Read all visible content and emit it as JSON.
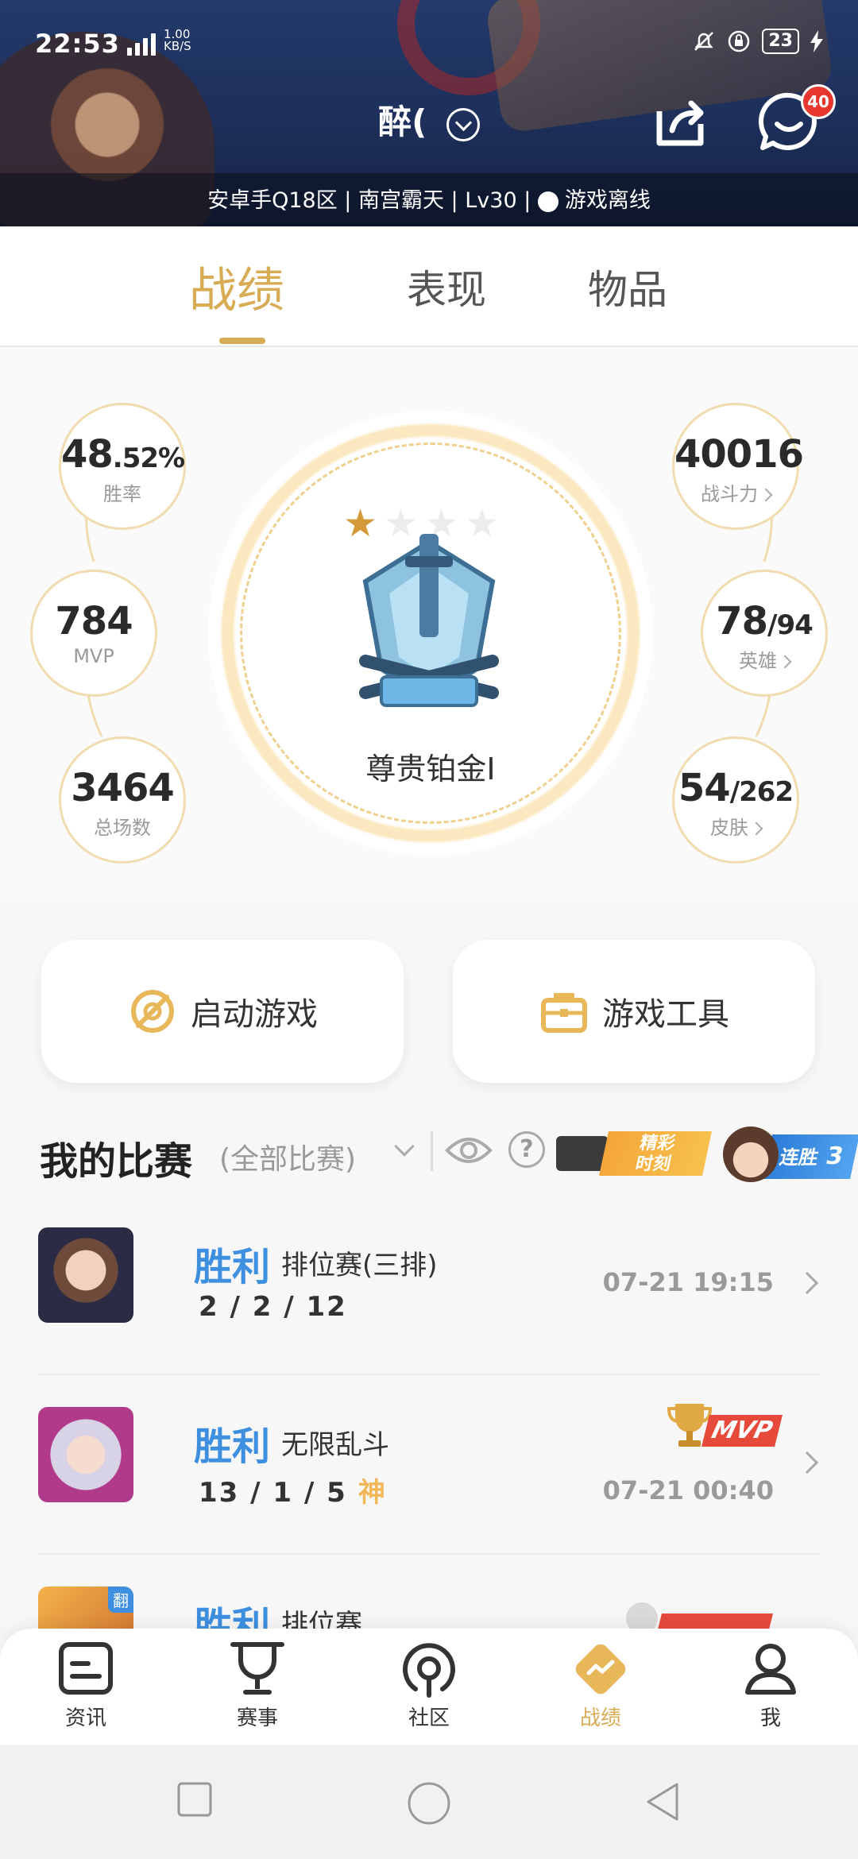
{
  "status_bar": {
    "time": "22:53",
    "network": "4G",
    "speed_value": "1.00",
    "speed_unit": "KB/S",
    "battery": "23"
  },
  "header": {
    "nickname": "醉(  ",
    "badge_count": "40",
    "info_strip": "安卓手Q18区 | 南宫霸天 | Lv30 | ",
    "status_text": "游戏离线"
  },
  "tabs": [
    {
      "label": "战绩",
      "active": true
    },
    {
      "label": "表现",
      "active": false
    },
    {
      "label": "物品",
      "active": false
    }
  ],
  "stats": {
    "win_rate": {
      "value": "48",
      "fraction": ".52%",
      "label": "胜率"
    },
    "mvp": {
      "value": "784",
      "label": "MVP"
    },
    "total_games": {
      "value": "3464",
      "label": "总场数"
    },
    "power": {
      "value": "40016",
      "label": "战斗力"
    },
    "heroes": {
      "value": "78",
      "total": "/94",
      "label": "英雄"
    },
    "skins": {
      "value": "54",
      "total": "/262",
      "label": "皮肤"
    }
  },
  "rank": {
    "name": "尊贵铂金I",
    "stars_earned": 1,
    "stars_total": 4
  },
  "actions": {
    "launch_game": "启动游戏",
    "game_tools": "游戏工具"
  },
  "matches_header": {
    "title": "我的比赛",
    "filter": "(全部比赛)",
    "highlight_line1": "精彩",
    "highlight_line2": "时刻",
    "streak_label": "连胜",
    "streak_count": "3"
  },
  "matches": [
    {
      "result": "胜利",
      "mode": "排位赛(三排)",
      "kda": "2 / 2 / 12",
      "god": "",
      "time": "07-21 19:15",
      "mvp": false
    },
    {
      "result": "胜利",
      "mode": "无限乱斗",
      "kda": "13 / 1 / 5",
      "god": "神",
      "time": "07-21 00:40",
      "mvp": true,
      "mvp_label": "MVP"
    },
    {
      "result": "胜利",
      "mode": "排位赛",
      "kda": "",
      "god": "",
      "time": "",
      "mvp": false,
      "corner": "翻"
    }
  ],
  "bottom_nav": [
    {
      "label": "资讯",
      "icon": "news-icon",
      "active": false
    },
    {
      "label": "赛事",
      "icon": "trophy-icon",
      "active": false
    },
    {
      "label": "社区",
      "icon": "community-icon",
      "active": false
    },
    {
      "label": "战绩",
      "icon": "record-icon",
      "active": true
    },
    {
      "label": "我",
      "icon": "profile-icon",
      "active": false
    }
  ],
  "colors": {
    "accent_gold": "#d8ac55",
    "win_blue": "#3e8fe0",
    "badge_red": "#e8372f",
    "mvp_red": "#e64a3b"
  }
}
